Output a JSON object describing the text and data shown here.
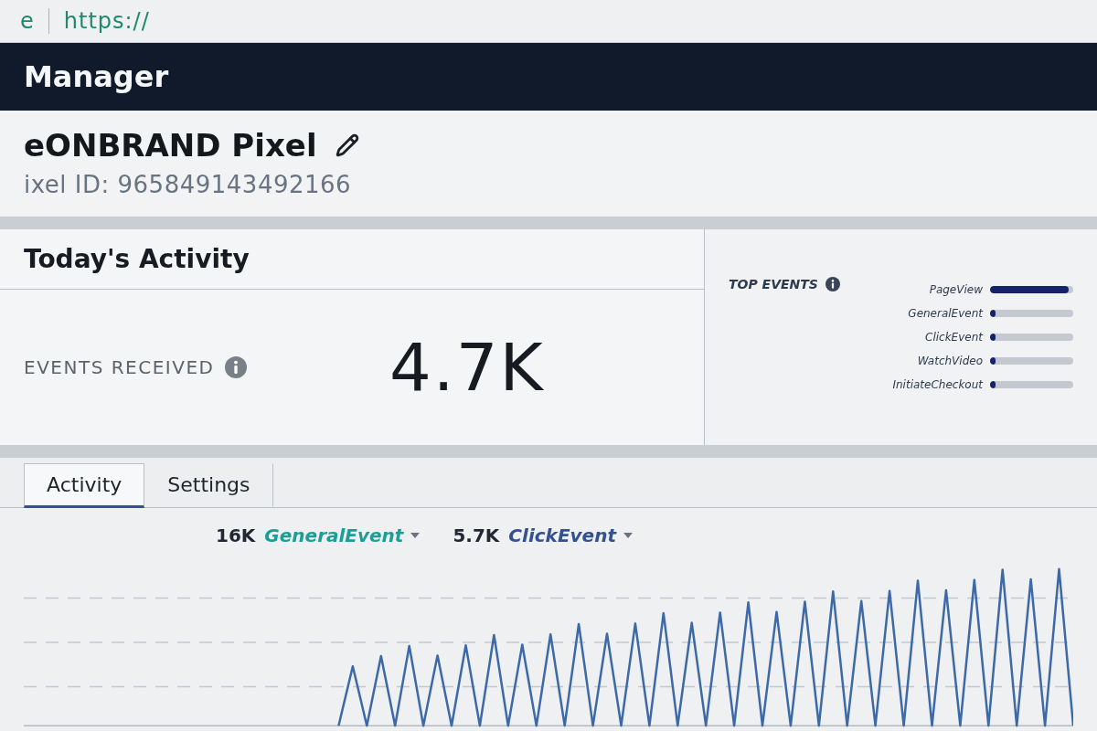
{
  "browser_bar": {
    "security_label": "e",
    "url": "https://"
  },
  "header": {
    "title": "Manager"
  },
  "pixel": {
    "name": "eONBRAND Pixel",
    "id_line": "ixel ID: 965849143492166"
  },
  "todays_activity": {
    "title": "Today's Activity",
    "metric_label": "EVENTS RECEIVED",
    "metric_value": "4.7K"
  },
  "top_events": {
    "title": "TOP EVENTS",
    "items": [
      {
        "name": "PageView",
        "level": 0.95
      },
      {
        "name": "GeneralEvent",
        "level": 0.05
      },
      {
        "name": "ClickEvent",
        "level": 0.03
      },
      {
        "name": "WatchVideo",
        "level": 0.01
      },
      {
        "name": "InitiateCheckout",
        "level": 0.01
      }
    ]
  },
  "tabs": [
    {
      "label": "Activity",
      "selected": true
    },
    {
      "label": "Settings",
      "selected": false
    }
  ],
  "legend": [
    {
      "count": "16K",
      "name": "GeneralEvent",
      "color": "#1a9e96"
    },
    {
      "count": "5.7K",
      "name": "ClickEvent",
      "color": "#34508f"
    }
  ]
}
